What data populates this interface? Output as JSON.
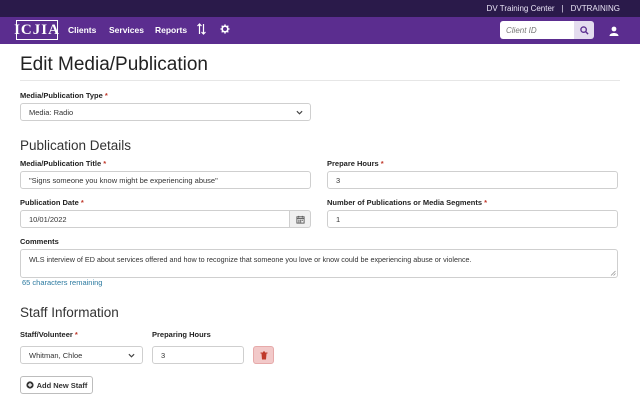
{
  "topbar": {
    "center_name": "DV Training Center",
    "separator": "|",
    "account": "DVTRAINING"
  },
  "nav": {
    "logo": "ICJIA",
    "links": [
      "Clients",
      "Services",
      "Reports"
    ],
    "sort_icon": "sort-arrows-icon",
    "settings_icon": "gear-icon",
    "search_placeholder": "Client ID",
    "search_icon": "search-icon",
    "user_icon": "user-icon",
    "bar_color": "#5b2d8f",
    "strip_color": "#2a1a4a"
  },
  "page": {
    "title": "Edit Media/Publication"
  },
  "type": {
    "label": "Media/Publication Type",
    "required": "*",
    "value": "Media: Radio"
  },
  "details": {
    "heading": "Publication Details",
    "title_label": "Media/Publication Title",
    "title_value": "\"Signs someone you know might be experiencing abuse\"",
    "prepare_label": "Prepare Hours",
    "prepare_value": "3",
    "date_label": "Publication Date",
    "date_value": "10/01/2022",
    "calendar_icon": "calendar-icon",
    "count_label": "Number of Publications or Media Segments",
    "count_value": "1",
    "comments_label": "Comments",
    "comments_value": "WLS interview of ED about services offered and how to recognize that someone you love or know could be experiencing abuse or violence.",
    "remaining": "65 characters remaining",
    "required": "*"
  },
  "staff": {
    "heading": "Staff Information",
    "staff_label": "Staff/Volunteer",
    "hours_label": "Preparing Hours",
    "rows": [
      {
        "name": "Whitman, Chloe",
        "hours": "3"
      }
    ],
    "delete_icon": "trash-icon",
    "add_label": "Add New Staff",
    "add_icon": "plus-circle-icon",
    "required": "*"
  }
}
